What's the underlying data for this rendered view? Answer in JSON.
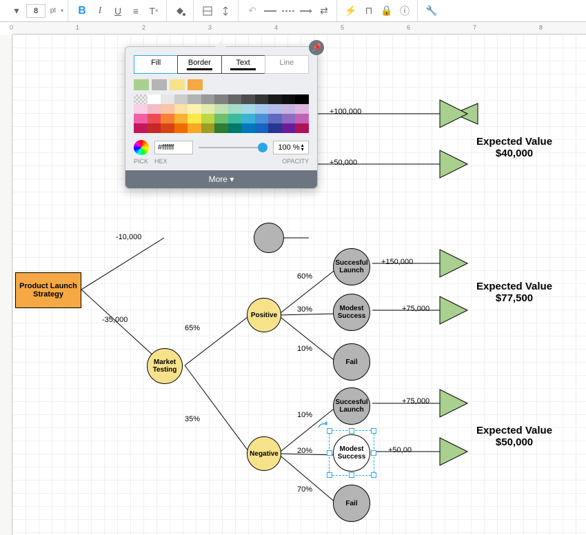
{
  "toolbar": {
    "font_size": "8",
    "font_unit": "pt"
  },
  "popup": {
    "tabs": {
      "fill": "Fill",
      "border": "Border",
      "text": "Text",
      "line": "Line"
    },
    "hex_value": "#ffffff",
    "opacity_value": "100 %",
    "label_pick": "PICK",
    "label_hex": "HEX",
    "label_opacity": "OPACITY",
    "more": "More"
  },
  "diagram": {
    "root": "Product Launch Strategy",
    "edge1": "-10,000",
    "edge2": "-35,000",
    "market_testing": "Market Testing",
    "positive": "Positive",
    "negative": "Negative",
    "pos_pct": "65%",
    "neg_pct": "35%",
    "p60": "60%",
    "p30": "30%",
    "p10a": "10%",
    "n10": "10%",
    "n20": "20%",
    "n70": "70%",
    "succesful": "Succesful Launch",
    "modest": "Modest Success",
    "fail": "Fail",
    "v100k": "+100,000",
    "v50k": "+50,000",
    "v150k": "+150,000",
    "v75k": "+75,000",
    "v75kb": "+75,000",
    "v50kb": "+50,00",
    "ev_label": "Expected Value",
    "ev1_val": "$40,000",
    "ev2_val": "$77,500",
    "ev3_val": "$50,000"
  }
}
